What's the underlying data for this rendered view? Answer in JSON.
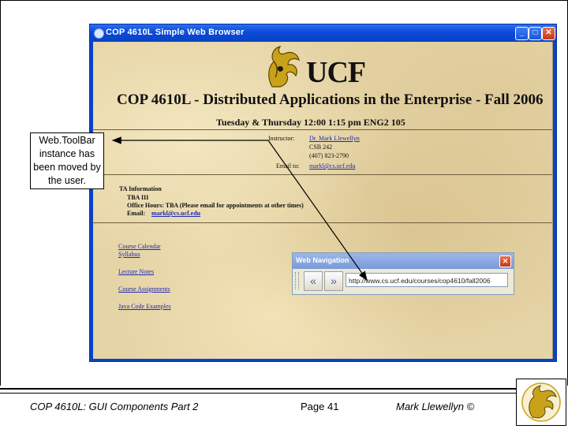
{
  "window": {
    "title": "COP 4610L Simple Web Browser",
    "minimize": "_",
    "maximize": "□",
    "close": "✕"
  },
  "page": {
    "logo_text": "UCF",
    "course_title": "COP 4610L - Distributed Applications in the Enterprise - Fall 2006",
    "schedule": "Tuesday & Thursday 12:00 1:15 pm ENG2 105",
    "instructor_label": "Instructor:",
    "instructor_name": "Dr. Mark Llewellyn",
    "office": "CSB 242",
    "phone": "(407) 823-2790",
    "email_label": "Email to:",
    "email": "markl@cs.ucf.edu",
    "ta_heading": "TA Information",
    "ta_name": "TBA III",
    "ta_office_hours": "Office Hours: TBA (Please email for appointments at other times)",
    "ta_email_label": "Email:",
    "ta_email": "markl@cs.ucf.edu",
    "links": [
      "Course Calendar",
      "Syllabus",
      "Lecture Notes",
      "Course Assignments",
      "Java Code Examples"
    ]
  },
  "web_navigation": {
    "title": "Web Navigation",
    "close": "✕",
    "back": "«",
    "forward": "»",
    "url": "http://www.cs.ucf.edu/courses/cop4610/fall2006"
  },
  "callout": {
    "text": "Web.ToolBar instance has been moved by the user."
  },
  "footer": {
    "course": "COP 4610L: GUI Components Part 2",
    "page": "Page 41",
    "author": "Mark Llewellyn ©"
  }
}
